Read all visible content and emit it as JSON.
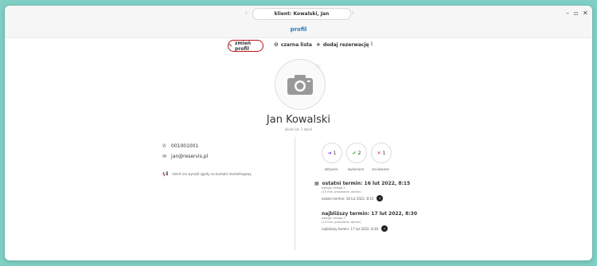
{
  "window": {
    "title": "klient: Kowalski, Jan",
    "nav_prev": "‹",
    "nav_next": "›",
    "minimize": "–",
    "maximize": "▫",
    "close": "✕"
  },
  "tab": {
    "label": "profil"
  },
  "actions": {
    "change_profile": "zmień profil",
    "blacklist": "czarna lista",
    "add_reservation": "dodaj rezerwację",
    "more": "⋮"
  },
  "profile": {
    "name": "Jan Kowalski",
    "since": "klient od: 1 dzień"
  },
  "contact": {
    "phone": "001001001",
    "email": "jan@reservis.pl",
    "marketing": "klient nie wyraził zgody na kontakt marketingowy"
  },
  "stats": [
    {
      "icon": "➜",
      "value": "1",
      "label": "aktywne",
      "color": "#8a2be2"
    },
    {
      "icon": "✔",
      "value": "2",
      "label": "wykonane",
      "color": "#2aa02a"
    },
    {
      "icon": "✕",
      "value": "1",
      "label": "anulowane",
      "color": "#d9262e"
    }
  ],
  "appointments": {
    "last": {
      "title": "ostatni termin: 16 lut 2022, 8:15",
      "line1": "usługa: Usługa 1",
      "line2": "(15 min, pracownik: admin)",
      "link": "ostatni termin: 16 lut 2022, 8:15"
    },
    "next": {
      "title": "najbliższy termin: 17 lut 2022, 8:30",
      "line1": "usługa: Usługa 1",
      "line2": "(15 min, pracownik: admin)",
      "link": "najbliższy termin: 17 lut 2022, 8:30"
    }
  }
}
